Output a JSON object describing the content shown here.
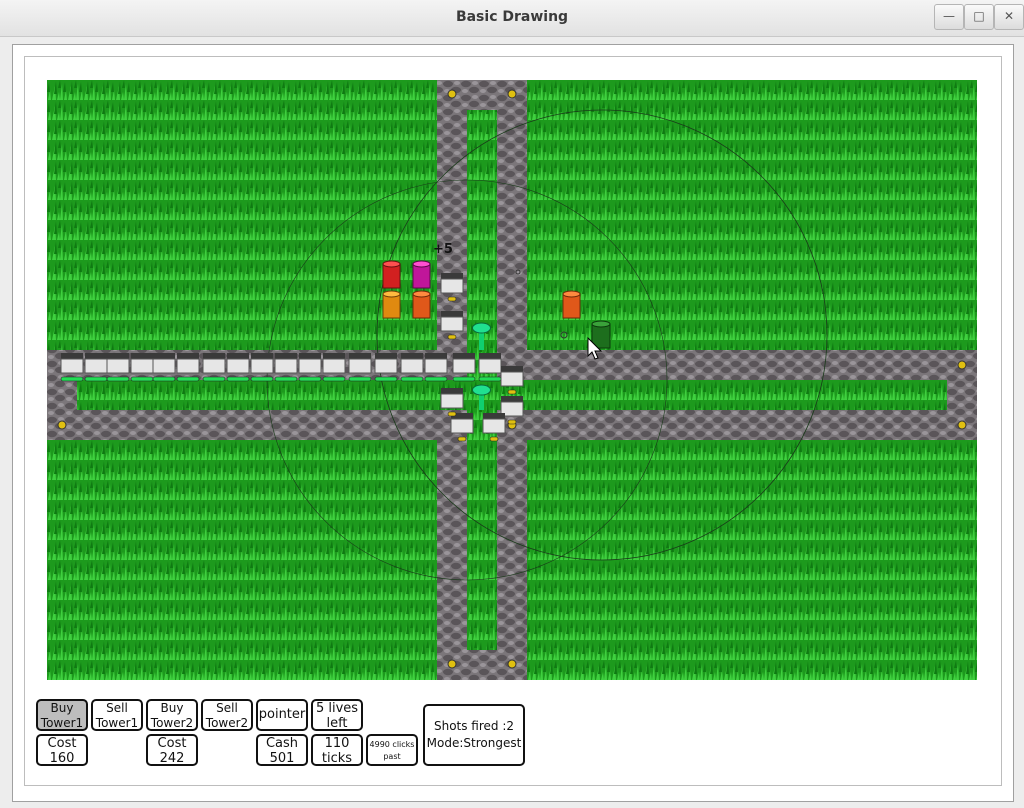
{
  "window": {
    "title": "Basic Drawing",
    "controls": [
      "minimize-icon",
      "maximize-icon",
      "close-icon"
    ]
  },
  "map": {
    "grass_color": "#1fa21f",
    "road_color": "#6f6a6e",
    "reward_text": "+5"
  },
  "controls": {
    "buy_tower1": [
      "Buy",
      "Tower1"
    ],
    "sell_tower1": [
      "Sell",
      "Tower1"
    ],
    "buy_tower2": [
      "Buy",
      "Tower2"
    ],
    "sell_tower2": [
      "Sell",
      "Tower2"
    ],
    "pointer": "pointer",
    "lives": [
      "5 lives",
      "left"
    ],
    "cost1": [
      "Cost",
      "160"
    ],
    "cost2": [
      "Cost",
      "242"
    ],
    "cash": [
      "Cash",
      "501"
    ],
    "ticks": [
      "110",
      "ticks"
    ],
    "clicks": [
      "4990 clicks",
      "past"
    ],
    "shots": "Shots fired :2",
    "mode": "Mode:Strongest"
  }
}
